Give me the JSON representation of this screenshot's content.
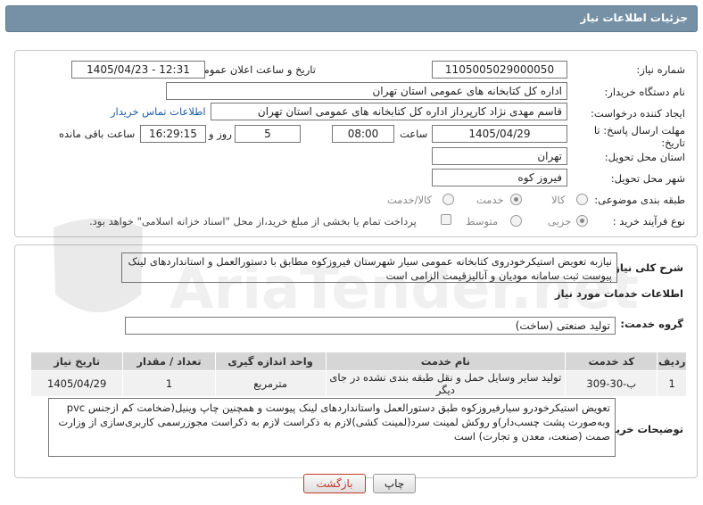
{
  "header": {
    "title": "جزئیات اطلاعات نیاز"
  },
  "form": {
    "need_number_label": "شماره نیاز:",
    "need_number_value": "1105005029000050",
    "announce_label": "تاریخ و ساعت اعلان عمومی:",
    "announce_value": "1405/04/23 - 12:31",
    "buyer_org_label": "نام دستگاه خریدار:",
    "buyer_org_value": "اداره کل کتابخانه های عمومی استان تهران",
    "requester_label": "ایجاد کننده درخواست:",
    "requester_value": "قاسم مهدی نژاد کارپرداز اداره کل کتابخانه های عمومی استان تهران",
    "contact_link": "اطلاعات تماس خریدار",
    "deadline_label": "مهلت ارسال پاسخ: تا تاریخ:",
    "deadline_date": "1405/04/29",
    "time_label": "ساعت",
    "deadline_time": "08:00",
    "days_value": "5",
    "days_label": "روز و",
    "remaining_time": "16:29:15",
    "remaining_label": "ساعت باقی مانده",
    "province_label": "استان محل تحویل:",
    "province_value": "تهران",
    "city_label": "شهر محل تحویل:",
    "city_value": "فیروز کوه",
    "category_label": "طبقه بندی موضوعی:",
    "category_options": [
      "کالا",
      "خدمت",
      "کالا/خدمت"
    ],
    "category_selected": "خدمت",
    "process_label": "نوع فرآیند خرید :",
    "process_options": [
      "جزیی",
      "متوسط"
    ],
    "process_selected": "جزیی",
    "payment_note": "پرداخت تمام یا بخشی از مبلغ خرید،از محل \"اسناد خزانه اسلامی\" خواهد بود."
  },
  "summary": {
    "label": "شرح کلی نیاز:",
    "value": "نیازبه تعویض استیکرخودروی کتابخانه عمومی سیار شهرستان فیروزکوه مطابق با دستورالعمل و استانداردهای لینک پیوست ثبت سامانه مودیان و آنالیزقیمت الزامی است"
  },
  "services": {
    "section_title": "اطلاعات خدمات مورد نیاز",
    "group_label": "گروه خدمت:",
    "group_value": "تولید صنعتی (ساخت)",
    "columns": [
      "ردیف",
      "کد خدمت",
      "نام خدمت",
      "واحد اندازه گیری",
      "تعداد / مقدار",
      "تاریخ نیاز"
    ],
    "rows": [
      [
        "1",
        "ب-30-309",
        "تولید سایر وسایل حمل و نقل طبقه بندی نشده در جای دیگر",
        "مترمربع",
        "1",
        "1405/04/29"
      ]
    ]
  },
  "buyer_notes": {
    "label": "توضیحات خریدار:",
    "value": "تعویض استیکرخودرو سیارفیروزکوه طبق دستورالعمل واستانداردهای لینک پیوست و همچنین چاپ وینیل(ضخامت کم ازجنس pvc وبه‌صورت پشت چسب‌دار)و روکش لمینت سرد(لمینت کشی)لازم به ذکراست لازم به ذکراست مجوزرسمی کاربری‌سازی از وزارت صمت (صنعت، معدن و تجارت) است"
  },
  "buttons": {
    "print": "چاپ",
    "back": "بازگشت"
  },
  "watermark": {
    "text": "AriaTender.net"
  },
  "colors": {
    "header": "#7691a6",
    "link": "#1a5ca8",
    "back_button": "#c0392b"
  }
}
